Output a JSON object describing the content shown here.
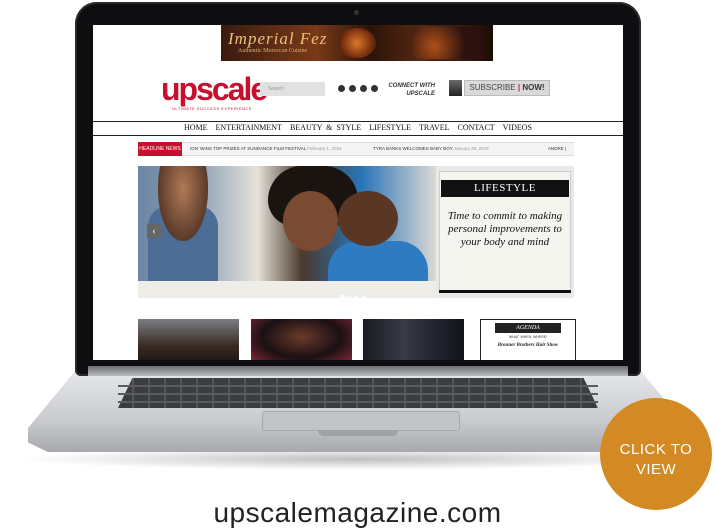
{
  "ad": {
    "title": "Imperial Fez",
    "tagline": "Authentic Moroccan Cuisine"
  },
  "site": {
    "logo": "upscale",
    "logo_tagline": "ULTIMATE SUCCESS EXPERIENCE",
    "search_placeholder": "Search",
    "social_icons": [
      "twitter-icon",
      "facebook-icon",
      "instagram-icon",
      "pinterest-icon"
    ],
    "connect": "CONNECT WITH UPSCALE",
    "subscribe": "SUBSCRIBE",
    "subscribe_sep": "|",
    "subscribe_now": "NOW!"
  },
  "nav": [
    "HOME",
    "ENTERTAINMENT",
    "BEAUTY & STYLE",
    "LIFESTYLE",
    "TRAVEL",
    "CONTACT",
    "VIDEOS"
  ],
  "ticker": {
    "label": "HEADLINE NEWS",
    "items": [
      {
        "text": "ION' WINS TOP PRIZES AT SUNDANCE FILM FESTIVAL",
        "date": "February 1, 2016"
      },
      {
        "text": "TYRA BANKS WELCOMES BABY BOY",
        "date": "January 28, 2016"
      }
    ],
    "more": "ANDRE |"
  },
  "slider": {
    "category": "LIFESTYLE",
    "caption": "Time to commit to making personal improvements to your body and mind",
    "prev": "‹",
    "next": "›"
  },
  "agenda": {
    "title": "AGENDA",
    "subtitle": "WHAT. WHEN. WHERE!",
    "item": "Bronner Brothers Hair Show"
  },
  "cta": {
    "line1": "CLICK TO",
    "line2": "VIEW",
    "color": "#d38a24"
  },
  "footer_url": "upscalemagazine.com",
  "colors": {
    "brand_red": "#c8102e"
  }
}
